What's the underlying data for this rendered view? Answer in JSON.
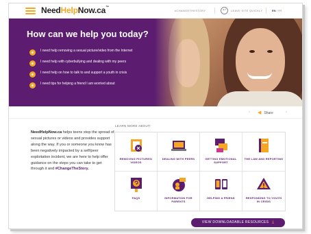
{
  "header": {
    "logo_part1": "Need",
    "logo_part2": "Help",
    "logo_part3": "Now.ca",
    "logo_tm": "™",
    "hashtag": "#CHANGETHESTORY",
    "leave_quickly": "LEAVE SITE QUICKLY",
    "lang_en": "EN",
    "lang_sep": "/",
    "lang_fr": "FR"
  },
  "hero": {
    "title": "How can we help you today?",
    "items": [
      "I need help removing a sexual picture/video from the Internet",
      "I need help with cyberbullying and dealing with my peers",
      "I need help on how to talk to and support a youth in crisis",
      "I need tips for helping a friend I am worried about"
    ]
  },
  "share": {
    "label": "Share",
    "prev": "‹",
    "next": "›"
  },
  "intro": {
    "brand": "NeedHelpNow.ca",
    "body": " helps teens stop the spread of sexual pictures or videos and provides support along the way. If you or someone you know has been negatively impacted by a self/peer exploitation incident, we are here to help offer guidance on the steps you can take to get through it and ",
    "hashtag": "#ChangeTheStory."
  },
  "learn_more": {
    "title": "LEARN MORE ABOUT:",
    "tiles": [
      {
        "label": "REMOVING PICTURES/ VIDEOS",
        "icon": "remove-image-icon"
      },
      {
        "label": "DEALING WITH PEERS",
        "icon": "laptop-icon"
      },
      {
        "label": "GETTING EMOTIONAL SUPPORT",
        "icon": "support-icon"
      },
      {
        "label": "THE LAW AND REPORTING",
        "icon": "law-book-icon"
      },
      {
        "label": "FAQS",
        "icon": "faq-icon"
      },
      {
        "label": "INFORMATION FOR PARENTS",
        "icon": "parents-icon"
      },
      {
        "label": "HELPING A FRIEND",
        "icon": "phones-icon"
      },
      {
        "label": "RESPONDING TO YOUTH IN CRISIS",
        "icon": "warning-icon"
      }
    ]
  },
  "resources_button": "VIEW DOWNLOADABLE RESOURCES",
  "colors": {
    "purple": "#5c1d70",
    "orange": "#f5a623"
  }
}
